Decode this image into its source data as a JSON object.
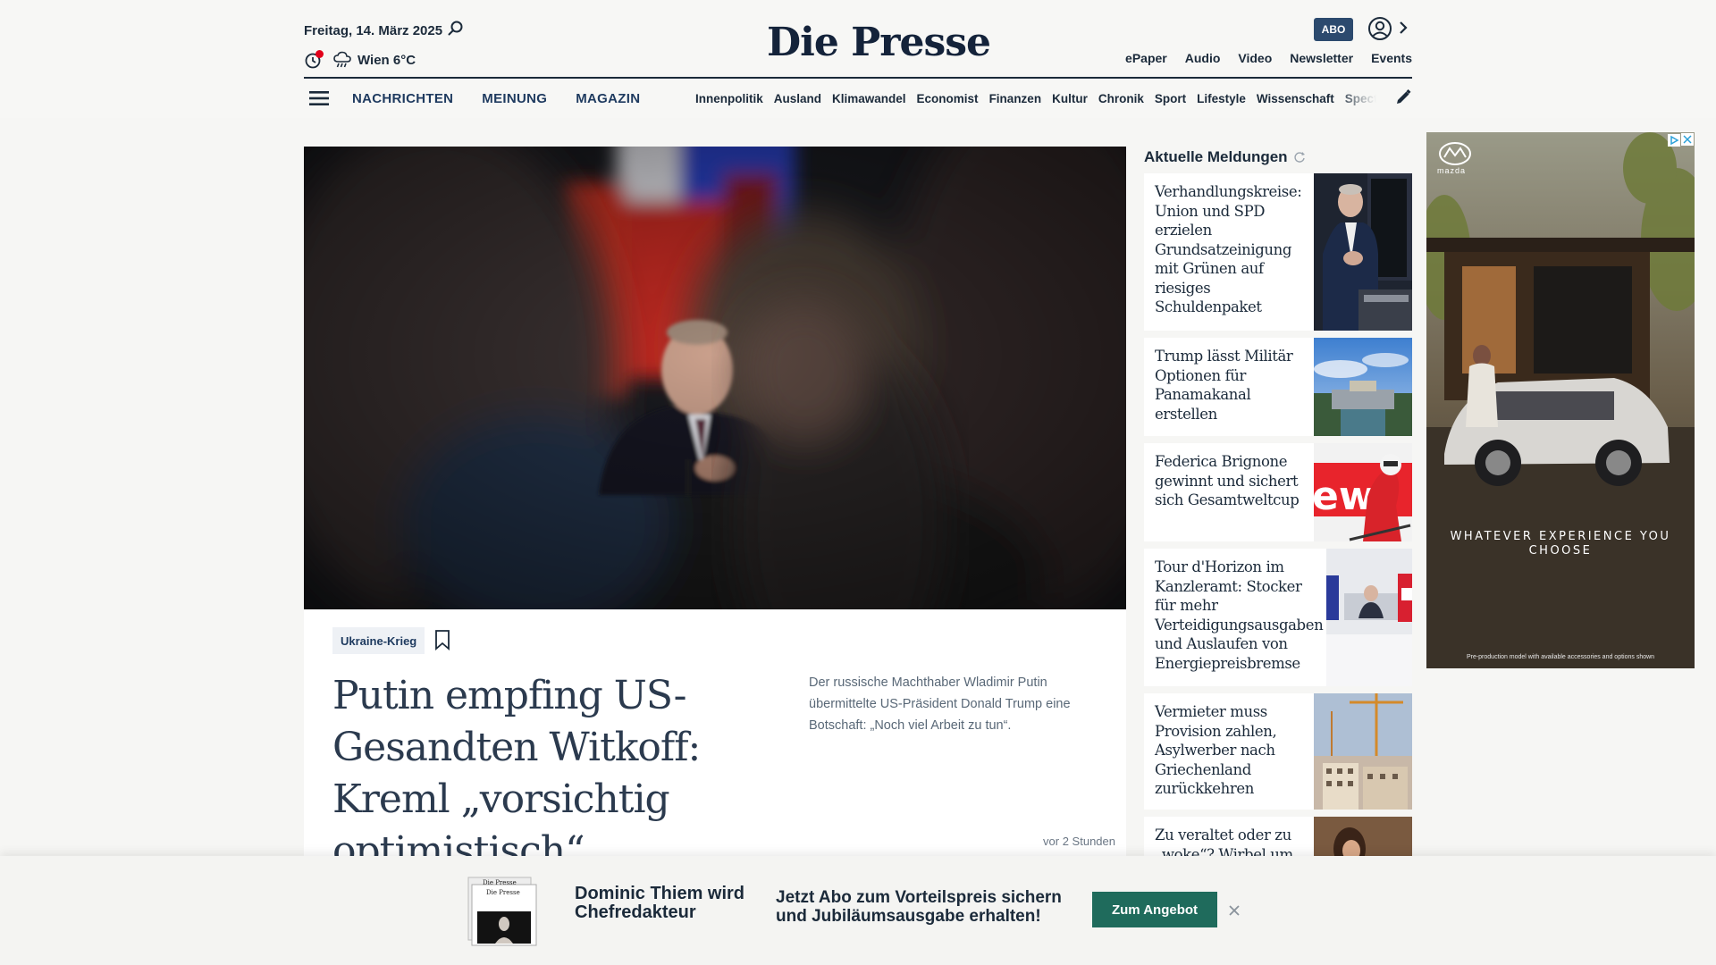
{
  "header": {
    "date": "Freitag, 14. März 2025",
    "weather": "Wien 6°C",
    "logo": "Die Presse",
    "abo_label": "ABO",
    "top_links": [
      "ePaper",
      "Audio",
      "Video",
      "Newsletter",
      "Events"
    ]
  },
  "nav": {
    "main": [
      "NACHRICHTEN",
      "MEINUNG",
      "MAGAZIN"
    ],
    "sub": [
      "Innenpolitik",
      "Ausland",
      "Klimawandel",
      "Economist",
      "Finanzen",
      "Kultur",
      "Chronik",
      "Sport",
      "Lifestyle",
      "Wissenschaft",
      "Spectrum"
    ]
  },
  "hero": {
    "tag": "Ukraine-Krieg",
    "headline": "Putin empfing US-Gesandten Witkoff: Kreml „vorsichtig optimistisch“",
    "teaser": "Der russische Machthaber Wladimir Putin übermittelte US-Präsident Donald Trump eine Botschaft: „Noch viel Arbeit zu tun“.",
    "age": "vor 2 Stunden"
  },
  "aktuell": {
    "title": "Aktuelle Meldungen",
    "items": [
      {
        "title": "Verhandlungskreise: Union und SPD erzielen Grundsatzeinigung mit Grünen auf riesiges Schuldenpaket"
      },
      {
        "title": "Trump lässt Militär Optionen für Panamakanal erstellen"
      },
      {
        "title": "Federica Brignone gewinnt und sichert sich Gesamtweltcup"
      },
      {
        "title": "Tour d'Horizon im Kanzleramt: Stocker für mehr Verteidigungsausgaben und Auslaufen von Energiepreisbremse"
      },
      {
        "title": "Vermieter muss Provision zahlen, Asylwerber nach Griechenland zurückkehren"
      },
      {
        "title": "Zu veraltet oder zu „woke“? Wirbel um"
      }
    ]
  },
  "ad": {
    "brand": "mazda",
    "tagline": "WHATEVER EXPERIENCE YOU CHOOSE",
    "disclaimer": "Pre-production model with available accessories and options shown"
  },
  "promo": {
    "name": "Dominic Thiem wird Chefredakteur",
    "offer": "Jetzt Abo zum Vorteilspreis sichern und Jubiläumsausgabe erhalten!",
    "button": "Zum Angebot",
    "paper_logo": "Die Presse"
  },
  "colors": {
    "brand_navy": "#14233a",
    "abo_blue": "#2c4a6e",
    "promo_green": "#1f6b5c",
    "alert_red": "#e2001a"
  }
}
